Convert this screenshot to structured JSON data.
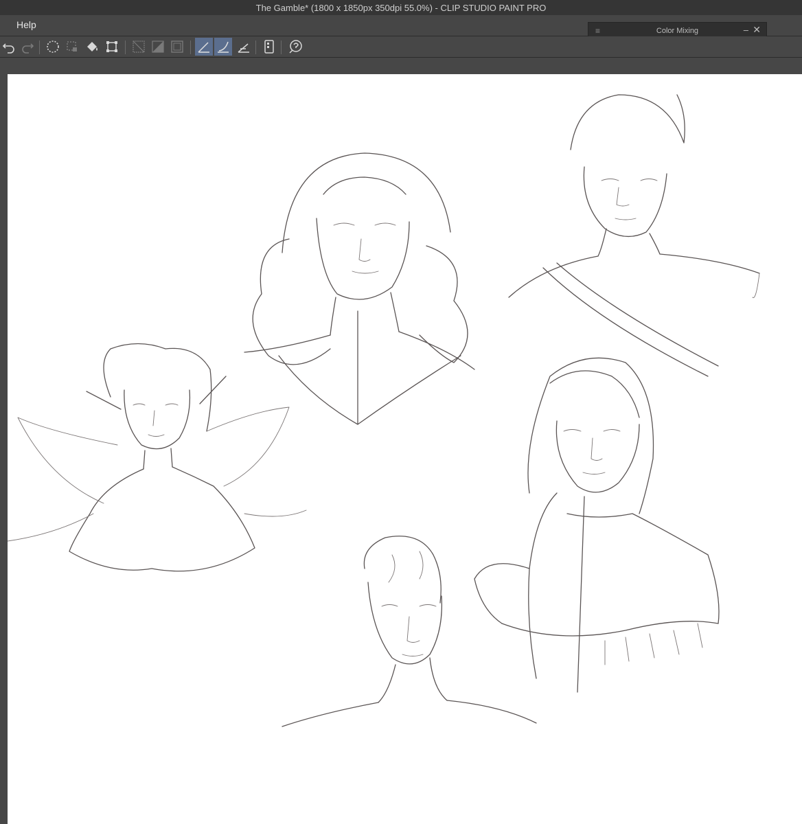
{
  "window": {
    "title": "The Gamble* (1800 x 1850px 350dpi 55.0%)  - CLIP STUDIO PAINT PRO"
  },
  "menu": {
    "help_label": "Help"
  },
  "panel": {
    "title": "Color Mixing",
    "minimize_glyph": "–",
    "close_glyph": "✕",
    "grip_glyph": "≡"
  },
  "toolbar": {
    "tools": [
      {
        "name": "undo-icon",
        "active": false
      },
      {
        "name": "redo-icon",
        "active": false
      },
      {
        "name": "select-all-icon",
        "active": false
      },
      {
        "name": "deselect-icon",
        "active": false
      },
      {
        "name": "fill-icon",
        "active": false
      },
      {
        "name": "transform-icon",
        "active": false
      },
      {
        "name": "clear-icon",
        "active": false
      },
      {
        "name": "clear-outside-icon",
        "active": false
      },
      {
        "name": "frame-icon",
        "active": false
      },
      {
        "name": "ruler-snap-icon",
        "active": true
      },
      {
        "name": "curve-snap-icon",
        "active": true
      },
      {
        "name": "perspective-snap-icon",
        "active": false
      },
      {
        "name": "tablet-icon",
        "active": false
      },
      {
        "name": "help-icon",
        "active": false
      }
    ]
  },
  "colors": {
    "titlebar_bg": "#353535",
    "ui_bg": "#474747",
    "active_tool": "#5b6e8e",
    "canvas_bg": "#ffffff",
    "sketch_line": "#5a5454"
  }
}
